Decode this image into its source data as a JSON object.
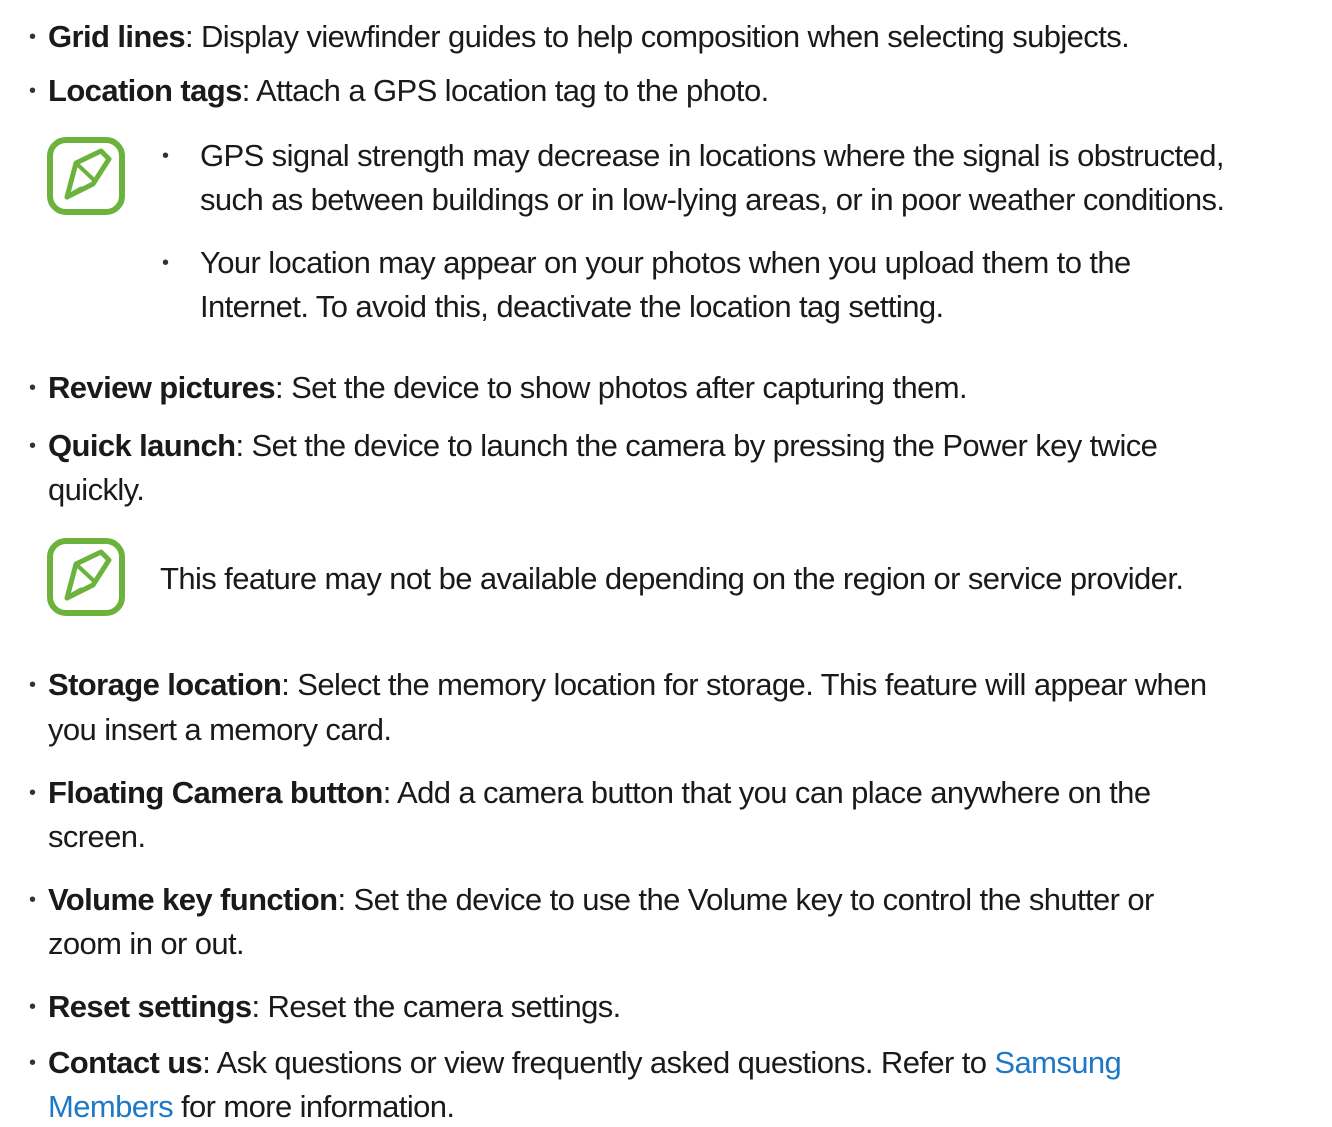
{
  "items": [
    {
      "term": "Grid lines",
      "desc": ": Display viewfinder guides to help composition when selecting subjects."
    },
    {
      "term": "Location tags",
      "desc": ": Attach a GPS location tag to the photo."
    },
    {
      "term": "Review pictures",
      "desc": ": Set the device to show photos after capturing them."
    },
    {
      "term": "Quick launch",
      "desc": ": Set the device to launch the camera by pressing the Power key twice",
      "cont": "quickly."
    },
    {
      "term": "Storage location",
      "desc": ": Select the memory location for storage. This feature will appear when",
      "cont": "you insert a memory card."
    },
    {
      "term": "Floating Camera button",
      "desc": ": Add a camera button that you can place anywhere on the",
      "cont": "screen."
    },
    {
      "term": "Volume key function",
      "desc": ": Set the device to use the Volume key to control the shutter or",
      "cont": "zoom in or out."
    },
    {
      "term": "Reset settings",
      "desc": ": Reset the camera settings."
    },
    {
      "term": "Contact us",
      "desc": ": Ask questions or view frequently asked questions. Refer to ",
      "link": "Samsung",
      "link_cont": "Members",
      "cont": " for more information."
    }
  ],
  "note1": [
    {
      "line1": "GPS signal strength may decrease in locations where the signal is obstructed,",
      "line2": "such as between buildings or in low-lying areas, or in poor weather conditions."
    },
    {
      "line1": "Your location may appear on your photos when you upload them to the",
      "line2": "Internet. To avoid this, deactivate the location tag setting."
    }
  ],
  "note2": {
    "text": "This feature may not be available depending on the region or service provider."
  },
  "icons": {
    "note": "note-pencil-icon"
  },
  "colors": {
    "note_icon": "#6cb33e",
    "link": "#1e78c8"
  }
}
